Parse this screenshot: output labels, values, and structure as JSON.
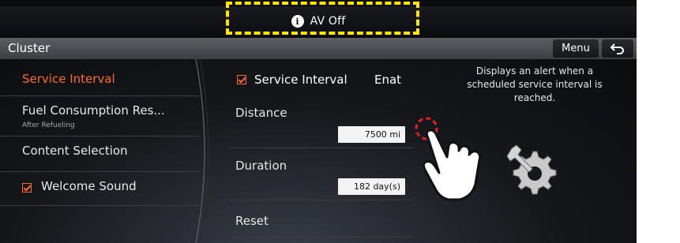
{
  "status_bar": {
    "icon": "info-icon",
    "text": "AV Off"
  },
  "header": {
    "title": "Cluster",
    "menu_label": "Menu",
    "back_icon": "back-arrow-icon"
  },
  "sidebar": {
    "items": [
      {
        "label": "Service Interval",
        "active": true
      },
      {
        "label": "Fuel Consumption Res...",
        "sublabel": "After Refueling"
      },
      {
        "label": "Content Selection"
      },
      {
        "label": "Welcome Sound",
        "checked": true
      }
    ]
  },
  "main": {
    "service_interval": {
      "label": "Service Interval",
      "state": "Enat",
      "checked": true
    },
    "distance": {
      "label": "Distance",
      "value": "7500 mi"
    },
    "duration": {
      "label": "Duration",
      "value": "182 day(s)"
    },
    "reset": {
      "label": "Reset"
    }
  },
  "description": "Displays an alert when a scheduled service interval is reached.",
  "colors": {
    "accent": "#ff6a2a",
    "highlight": "#ffe600",
    "tap_marker": "#e02020"
  },
  "overlays": {
    "hand": "tap-hand-icon",
    "gear": "wrench-gear-icon"
  }
}
